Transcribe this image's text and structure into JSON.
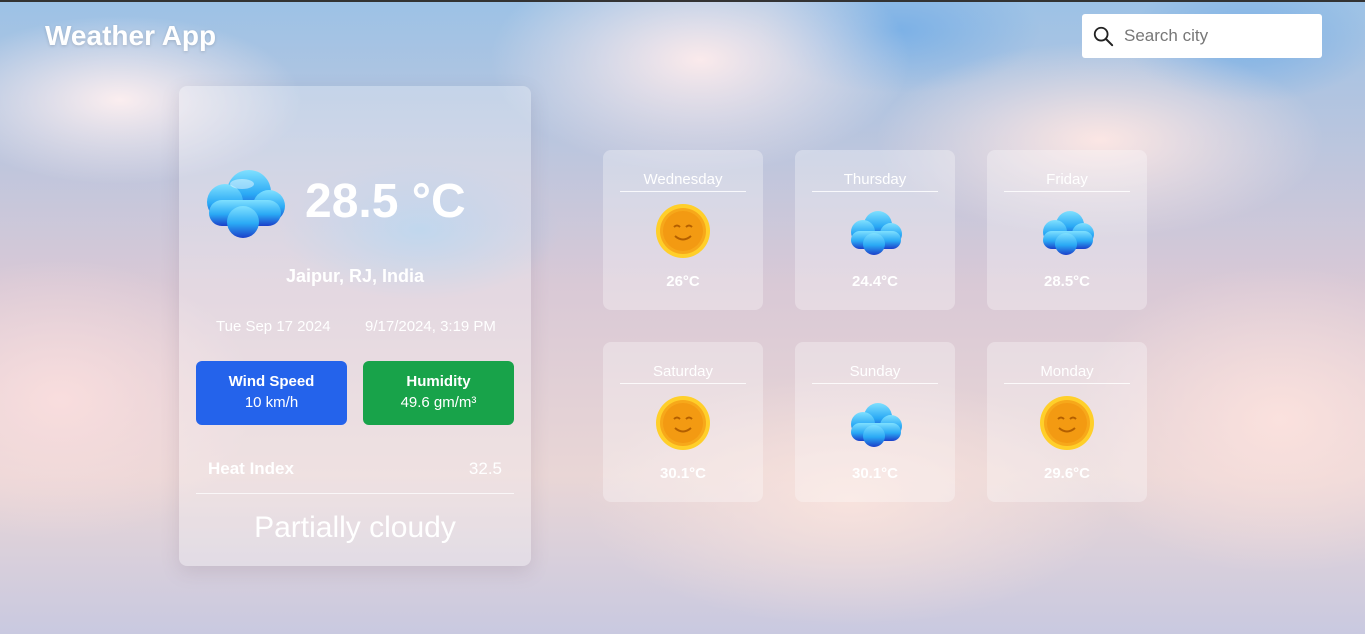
{
  "app": {
    "title": "Weather App"
  },
  "search": {
    "placeholder": "Search city",
    "icon": "search-icon"
  },
  "current": {
    "icon": "cloud-icon",
    "temperature": "28.5 °C",
    "location": "Jaipur, RJ, India",
    "date": "Tue Sep 17 2024",
    "datetime": "9/17/2024, 3:19 PM",
    "wind": {
      "label": "Wind Speed",
      "value": "10 km/h",
      "color": "#2463eb"
    },
    "humidity": {
      "label": "Humidity",
      "value": "49.6 gm/m³",
      "color": "#18a34a"
    },
    "heat_index": {
      "label": "Heat Index",
      "value": "32.5"
    },
    "condition": "Partially cloudy"
  },
  "forecast": [
    {
      "day": "Wednesday",
      "temp": "26°C",
      "icon": "sun-icon"
    },
    {
      "day": "Thursday",
      "temp": "24.4°C",
      "icon": "cloud-icon"
    },
    {
      "day": "Friday",
      "temp": "28.5°C",
      "icon": "cloud-icon"
    },
    {
      "day": "Saturday",
      "temp": "30.1°C",
      "icon": "sun-icon"
    },
    {
      "day": "Sunday",
      "temp": "30.1°C",
      "icon": "cloud-icon"
    },
    {
      "day": "Monday",
      "temp": "29.6°C",
      "icon": "sun-icon"
    }
  ]
}
